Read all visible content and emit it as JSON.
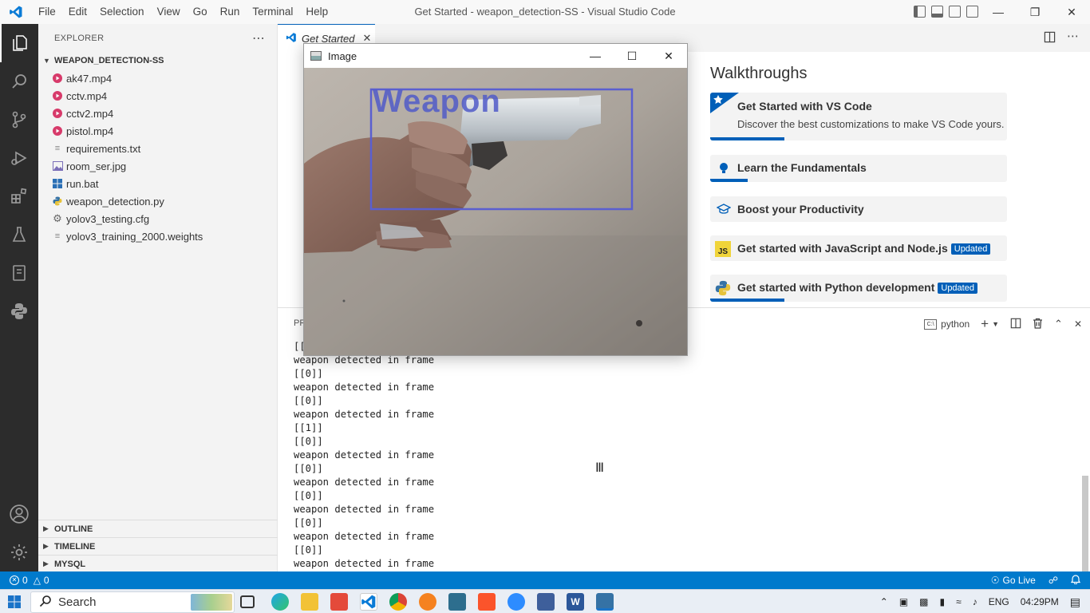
{
  "window": {
    "title": "Get Started - weapon_detection-SS - Visual Studio Code",
    "menu": [
      "File",
      "Edit",
      "Selection",
      "View",
      "Go",
      "Run",
      "Terminal",
      "Help"
    ]
  },
  "explorer": {
    "header": "EXPLORER",
    "folder": "WEAPON_DETECTION-SS",
    "files": [
      {
        "name": "ak47.mp4",
        "icon": "video-file-icon"
      },
      {
        "name": "cctv.mp4",
        "icon": "video-file-icon"
      },
      {
        "name": "cctv2.mp4",
        "icon": "video-file-icon"
      },
      {
        "name": "pistol.mp4",
        "icon": "video-file-icon"
      },
      {
        "name": "requirements.txt",
        "icon": "text-file-icon"
      },
      {
        "name": "room_ser.jpg",
        "icon": "image-file-icon"
      },
      {
        "name": "run.bat",
        "icon": "windows-file-icon"
      },
      {
        "name": "weapon_detection.py",
        "icon": "python-file-icon"
      },
      {
        "name": "yolov3_testing.cfg",
        "icon": "gear-file-icon"
      },
      {
        "name": "yolov3_training_2000.weights",
        "icon": "text-file-icon"
      }
    ],
    "sections": [
      "OUTLINE",
      "TIMELINE",
      "MYSQL"
    ]
  },
  "editor": {
    "tab_label": "Get Started",
    "walkthroughs_title": "Walkthroughs",
    "cards": [
      {
        "title": "Get Started with VS Code",
        "desc": "Discover the best customizations to make VS Code yours.",
        "badge": ""
      },
      {
        "title": "Learn the Fundamentals",
        "desc": "",
        "badge": ""
      },
      {
        "title": "Boost your Productivity",
        "desc": "",
        "badge": ""
      },
      {
        "title": "Get started with JavaScript and Node.js",
        "desc": "",
        "badge": "Updated"
      },
      {
        "title": "Get started with Python development",
        "desc": "",
        "badge": "Updated"
      }
    ]
  },
  "image_window": {
    "title": "Image",
    "detection_label": "Weapon"
  },
  "panel": {
    "tab_partial": "PR",
    "terminal_name": "python",
    "lines": [
      "[[0]]",
      "weapon detected in frame",
      "[[0]]",
      "weapon detected in frame",
      "[[0]]",
      "weapon detected in frame",
      "[[1]]",
      "[[0]]",
      "weapon detected in frame",
      "[[0]]",
      "weapon detected in frame",
      "[[0]]",
      "weapon detected in frame",
      "[[0]]",
      "weapon detected in frame",
      "[[0]]",
      "weapon detected in frame"
    ]
  },
  "statusbar": {
    "errors": "0",
    "warnings": "0",
    "go_live": "Go Live"
  },
  "taskbar": {
    "search_placeholder": "Search",
    "language": "ENG",
    "time": "04:29PM"
  },
  "colors": {
    "accent": "#005fb8",
    "statusbar": "#007acc",
    "activitybar": "#2c2c2c",
    "detection_box": "#5a5fd0"
  }
}
